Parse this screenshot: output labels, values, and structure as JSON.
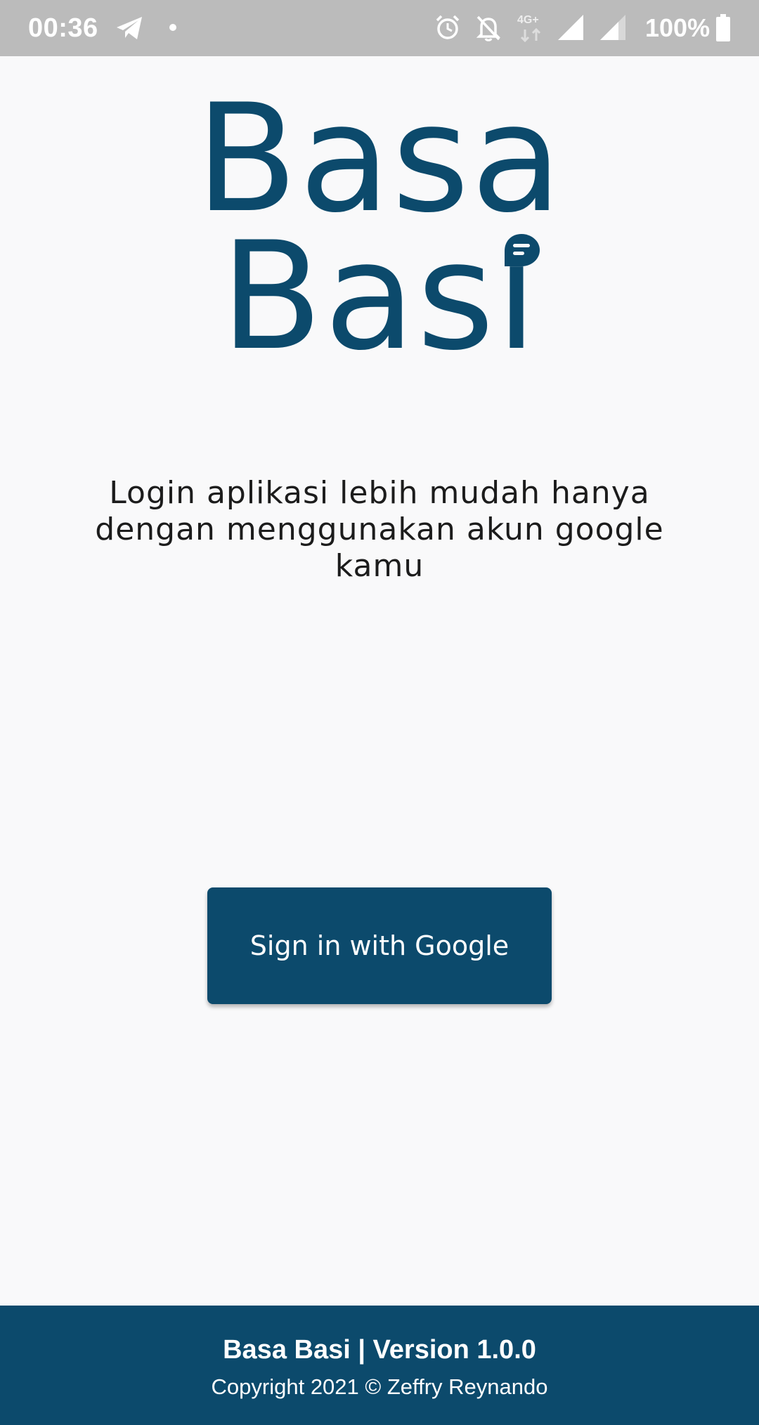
{
  "status_bar": {
    "time": "00:36",
    "battery": "100%",
    "network_label": "4G+",
    "icons": [
      "telegram-icon",
      "notification-dot-icon",
      "alarm-icon",
      "bell-off-icon",
      "data-4g-plus-icon",
      "signal-icon",
      "signal-icon",
      "battery-icon"
    ]
  },
  "logo": {
    "line1": "Basa",
    "line2": "Bası"
  },
  "description": "Login aplikasi lebih mudah hanya dengan menggunakan akun google kamu",
  "signin_button": {
    "label": "Sign in with Google"
  },
  "footer": {
    "title": "Basa Basi | Version 1.0.0",
    "copyright": "Copyright 2021 © Zeffry Reynando"
  },
  "colors": {
    "primary": "#0c4a6c",
    "background": "#f9f9fa",
    "status_bar": "#bbbbbb",
    "text": "#1c1c1c"
  }
}
